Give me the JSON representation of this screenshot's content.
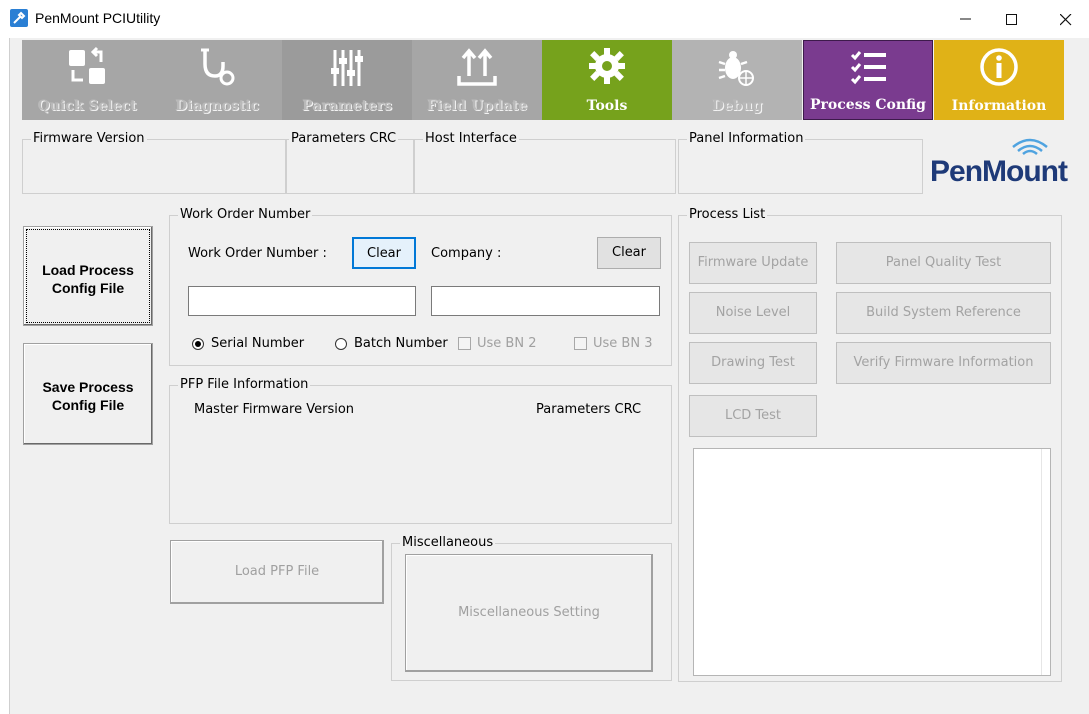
{
  "window": {
    "title": "PenMount PCIUtility",
    "minimize_glyph": "—",
    "close_glyph": "✕"
  },
  "toolbar": {
    "items": [
      {
        "label": "Quick Select",
        "icon": "quick-select-icon",
        "state": "disabled",
        "color": "#a6a6a6"
      },
      {
        "label": "Diagnostic",
        "icon": "stethoscope-icon",
        "state": "disabled",
        "color": "#a6a6a6"
      },
      {
        "label": "Parameters",
        "icon": "sliders-icon",
        "state": "disabled",
        "color": "#a6a6a6"
      },
      {
        "label": "Field Update",
        "icon": "upload-icon",
        "state": "disabled",
        "color": "#a6a6a6"
      },
      {
        "label": "Tools",
        "icon": "gear-icon",
        "state": "enabled",
        "color": "#76a21c"
      },
      {
        "label": "Debug",
        "icon": "bug-icon",
        "state": "disabled",
        "color": "#a6a6a6"
      },
      {
        "label": "Process Config",
        "icon": "checklist-icon",
        "state": "active",
        "color": "#7a3b8f"
      },
      {
        "label": "Information",
        "icon": "info-icon",
        "state": "enabled",
        "color": "#e0b217"
      }
    ]
  },
  "info_bar": {
    "firmware_version": "Firmware Version",
    "parameters_crc": "Parameters CRC",
    "host_interface": "Host Interface",
    "panel_information": "Panel Information"
  },
  "logo": {
    "text": "PenMount"
  },
  "left_buttons": {
    "load_process": "Load Process Config File",
    "save_process": "Save Process Config File"
  },
  "work_order": {
    "group_title": "Work Order Number",
    "wo_label": "Work Order Number :",
    "wo_clear": "Clear",
    "company_label": "Company :",
    "company_clear": "Clear",
    "wo_value": "",
    "company_value": "",
    "serial_number": "Serial Number",
    "batch_number": "Batch Number",
    "use_bn2": "Use BN 2",
    "use_bn3": "Use BN 3",
    "selected": "Serial Number"
  },
  "pfp": {
    "group_title": "PFP File Information",
    "master_fw": "Master Firmware Version",
    "params_crc": "Parameters CRC"
  },
  "load_pfp": "Load PFP File",
  "misc": {
    "group_title": "Miscellaneous",
    "setting_button": "Miscellaneous Setting"
  },
  "process_list": {
    "group_title": "Process List",
    "buttons": {
      "firmware_update": "Firmware Update",
      "panel_quality_test": "Panel Quality Test",
      "noise_level": "Noise Level",
      "build_system_reference": "Build System Reference",
      "drawing_test": "Drawing Test",
      "verify_firmware_information": "Verify Firmware Information",
      "lcd_test": "LCD Test"
    }
  }
}
